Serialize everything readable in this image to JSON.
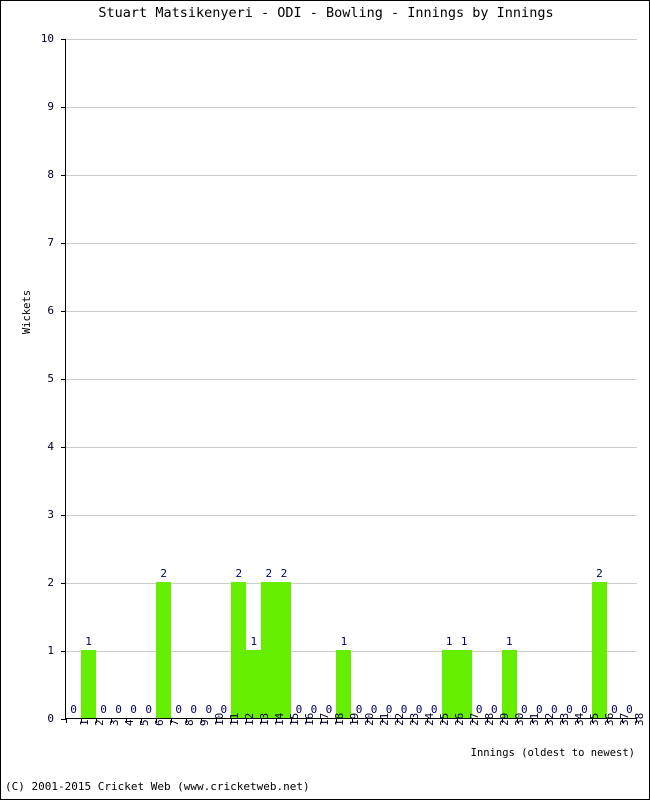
{
  "chart_data": {
    "type": "bar",
    "title": "Stuart Matsikenyeri - ODI - Bowling - Innings by Innings",
    "xlabel": "Innings (oldest to newest)",
    "ylabel": "Wickets",
    "ylim": [
      0,
      10
    ],
    "yticks": [
      0,
      1,
      2,
      3,
      4,
      5,
      6,
      7,
      8,
      9,
      10
    ],
    "grid": true,
    "legend": null,
    "bar_color": "#66ee00",
    "label_color": "#000066",
    "categories": [
      "1",
      "2",
      "3",
      "4",
      "5",
      "6",
      "7",
      "8",
      "9",
      "10",
      "11",
      "12",
      "13",
      "14",
      "15",
      "16",
      "17",
      "18",
      "19",
      "20",
      "21",
      "22",
      "23",
      "24",
      "25",
      "26",
      "27",
      "28",
      "29",
      "30",
      "31",
      "32",
      "33",
      "34",
      "35",
      "36",
      "37",
      "38"
    ],
    "values": [
      0,
      1,
      0,
      0,
      0,
      0,
      2,
      0,
      0,
      0,
      0,
      2,
      1,
      2,
      2,
      0,
      0,
      0,
      1,
      0,
      0,
      0,
      0,
      0,
      0,
      1,
      1,
      0,
      0,
      1,
      0,
      0,
      0,
      0,
      0,
      2,
      0,
      0
    ],
    "point_labels": [
      "0",
      "1",
      "0",
      "0",
      "0",
      "0",
      "2",
      "0",
      "0",
      "0",
      "0",
      "2",
      "1",
      "2",
      "2",
      "0",
      "0",
      "0",
      "1",
      "0",
      "0",
      "0",
      "0",
      "0",
      "0",
      "1",
      "1",
      "0",
      "0",
      "1",
      "0",
      "0",
      "0",
      "0",
      "0",
      "2",
      "0",
      "0"
    ]
  },
  "footer": {
    "copyright": "(C) 2001-2015 Cricket Web (www.cricketweb.net)"
  }
}
